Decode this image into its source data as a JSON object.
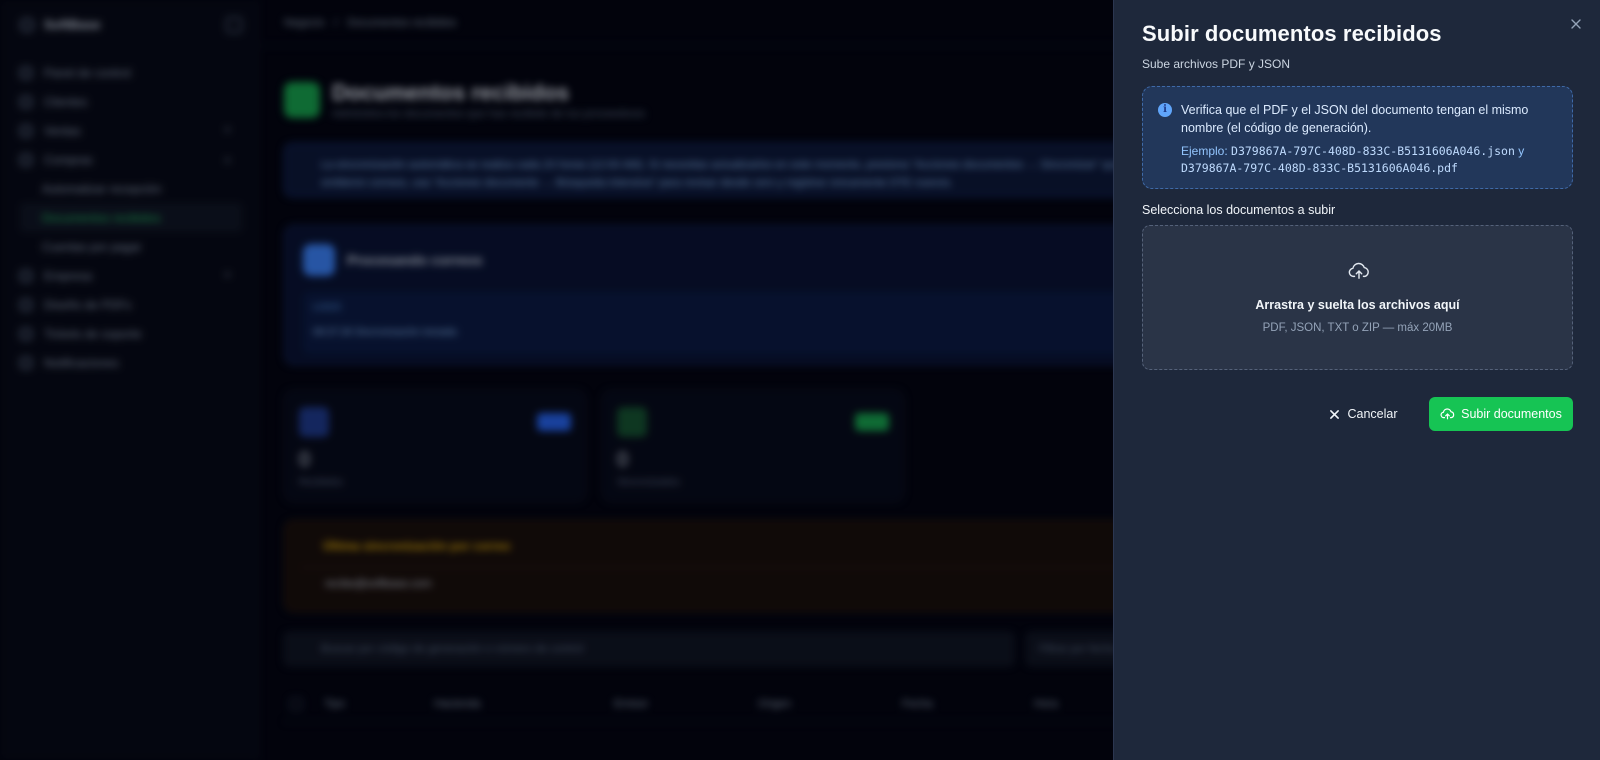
{
  "background": {
    "brand": "SoftBase",
    "sidebar": {
      "items": [
        {
          "label": "Panel de control"
        },
        {
          "label": "Clientes"
        },
        {
          "label": "Ventas"
        },
        {
          "label": "Compras"
        },
        {
          "label": "Automatizar recepción"
        },
        {
          "label": "Documentos recibidos"
        },
        {
          "label": "Cuentas por pagar"
        },
        {
          "label": "Empresa"
        },
        {
          "label": "Diseño de PDFs"
        },
        {
          "label": "Tickets de soporte"
        },
        {
          "label": "Notificaciones"
        }
      ]
    },
    "breadcrumb": {
      "root": "Negocio",
      "separator": "/",
      "current": "Documentos recibidos"
    },
    "page": {
      "title": "Documentos recibidos",
      "subtitle": "Administra los documentos que has recibido de tus proveedores"
    },
    "info_banner": "La sincronización automática se realiza cada 24 horas (12:00 AM). Si necesitas actualizarlos en este momento, presiona \"Acciones documentos → Sincronizar\" que se omitieron correos, usa \"Acciones documento → Búsqueda intensiva\" para revisar desde cero y registrar únicamente DTE nuevos.",
    "processing": {
      "title": "Procesando correos",
      "log_label": "LOGS",
      "log_line": "08:37:28  Sincronización iniciada"
    },
    "stats": [
      {
        "value": "0",
        "label": "Recibidos"
      },
      {
        "value": "0",
        "label": "Sincronizados"
      }
    ],
    "last_sync": {
      "title": "Última sincronización por correo",
      "email": "recibe@softbase.com"
    },
    "search_placeholder": "Buscar por código de generación o número de control",
    "filter_placeholder": "Filtrar por fecha",
    "table_headers": [
      "Tipo",
      "Hacienda",
      "Emisor",
      "Origen",
      "Fecha",
      "Hora"
    ]
  },
  "drawer": {
    "title": "Subir documentos recibidos",
    "subtitle": "Sube archivos PDF y JSON",
    "notice": {
      "text": "Verifica que el PDF y el JSON del documento tengan el mismo nombre (el código de generación).",
      "example_prefix": "Ejemplo:",
      "example_json": "D379867A-797C-408D-833C-B5131606A046.json",
      "example_join": "y",
      "example_pdf": "D379867A-797C-408D-833C-B5131606A046.pdf"
    },
    "select_label": "Selecciona los documentos a subir",
    "dropzone": {
      "icon": "cloud-upload-icon",
      "main": "Arrastra y suelta los archivos aquí",
      "sub": "PDF, JSON, TXT o ZIP — máx 20MB"
    },
    "cancel_label": "Cancelar",
    "upload_label": "Subir documentos"
  },
  "colors": {
    "drawer_bg": "#1e283b",
    "accent_green": "#16c454",
    "notice_bg": "#22375a",
    "notice_border": "#3f6aa8"
  }
}
